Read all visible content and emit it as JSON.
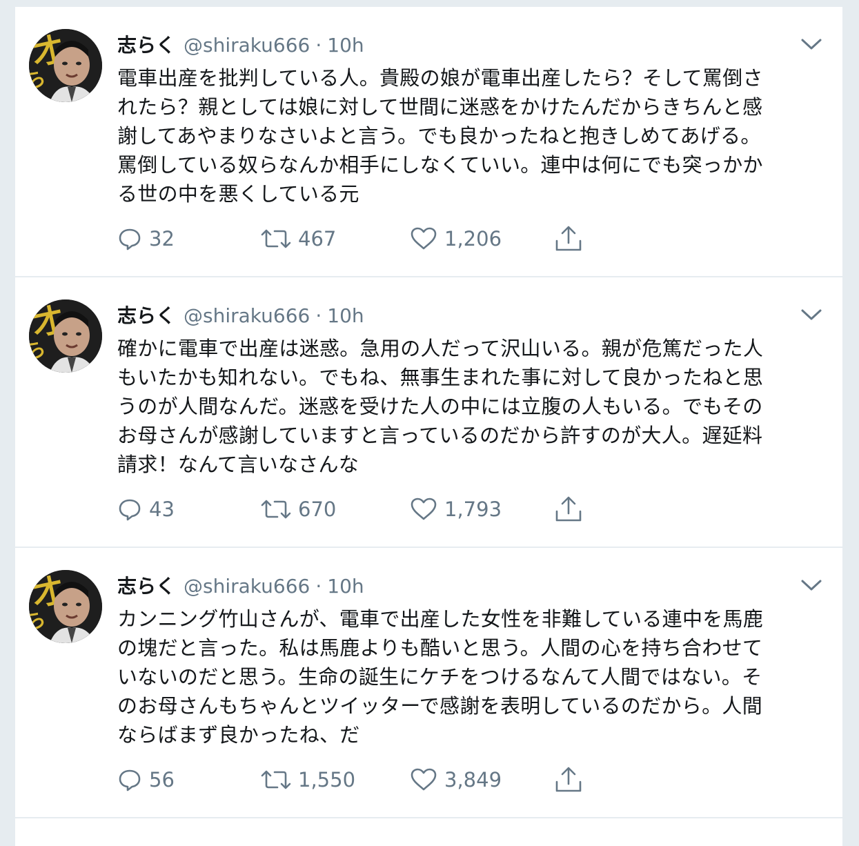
{
  "colors": {
    "background": "#e6ecf0",
    "card": "#ffffff",
    "text": "#14171a",
    "secondary": "#657786"
  },
  "tweets": [
    {
      "author": {
        "name": "志らく",
        "handle": "@shiraku666",
        "avatar": "avatar-image"
      },
      "separator": "·",
      "time": "10h",
      "text": "電車出産を批判している人。貴殿の娘が電車出産したら？そして罵倒さ\nれたら？親としては娘に対して世間に迷惑をかけたんだからきちんと感\n謝してあやまりなさいよと言う。でも良かったねと抱きしめてあげる。\n罵倒している奴らなんか相手にしなくていい。連中は何にでも突っかか\nる世の中を悪くしている元",
      "replies": "32",
      "retweets": "467",
      "likes": "1,206"
    },
    {
      "author": {
        "name": "志らく",
        "handle": "@shiraku666",
        "avatar": "avatar-image"
      },
      "separator": "·",
      "time": "10h",
      "text": "確かに電車で出産は迷惑。急用の人だって沢山いる。親が危篤だった人\nもいたかも知れない。でもね、無事生まれた事に対して良かったねと思\nうのが人間なんだ。迷惑を受けた人の中には立腹の人もいる。でもその\nお母さんが感謝していますと言っているのだから許すのが大人。遅延料\n請求！なんて言いなさんな",
      "replies": "43",
      "retweets": "670",
      "likes": "1,793"
    },
    {
      "author": {
        "name": "志らく",
        "handle": "@shiraku666",
        "avatar": "avatar-image"
      },
      "separator": "·",
      "time": "10h",
      "text": "カンニング竹山さんが、電車で出産した女性を非難している連中を馬鹿\nの塊だと言った。私は馬鹿よりも酷いと思う。人間の心を持ち合わせて\nいないのだと思う。生命の誕生にケチをつけるなんて人間ではない。そ\nのお母さんもちゃんとツイッターで感謝を表明しているのだから。人間\nならばまず良かったね、だ",
      "replies": "56",
      "retweets": "1,550",
      "likes": "3,849"
    }
  ],
  "icons": {
    "reply": "reply-icon",
    "retweet": "retweet-icon",
    "like": "heart-icon",
    "share": "share-icon",
    "more": "chevron-down-icon"
  }
}
